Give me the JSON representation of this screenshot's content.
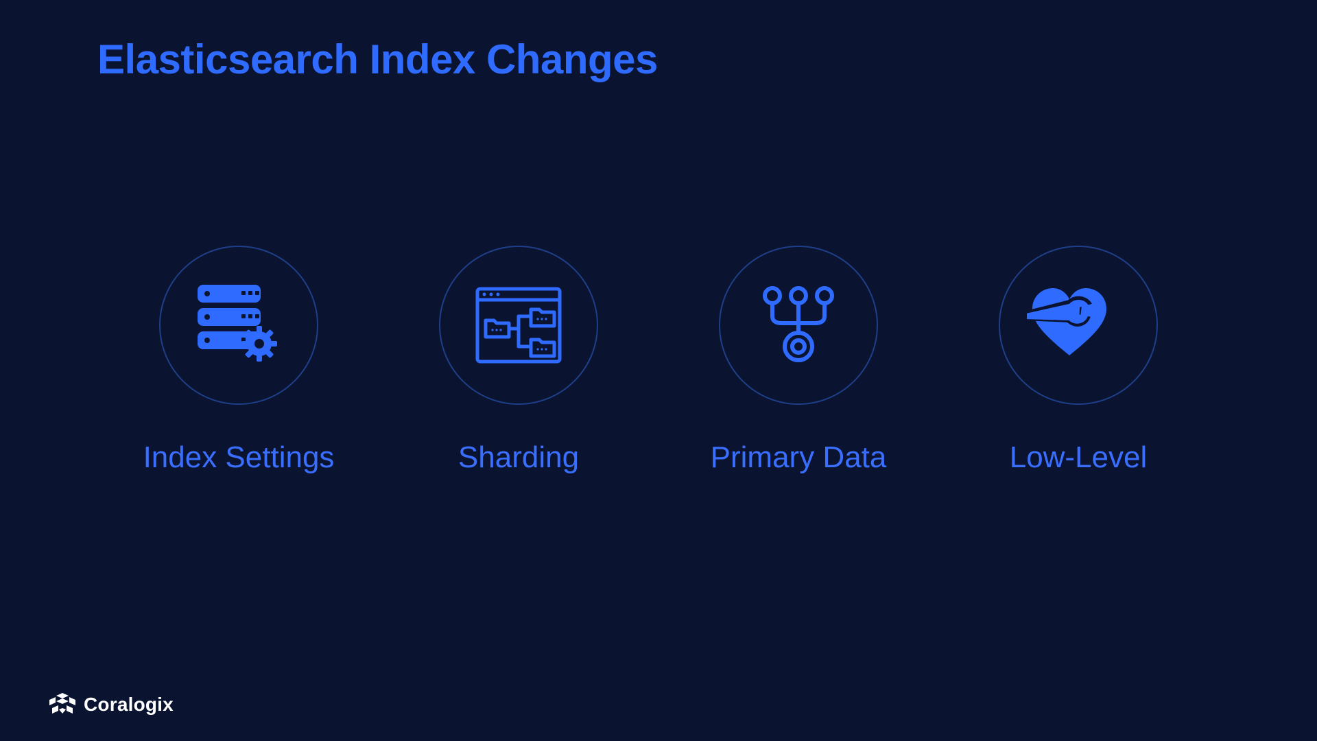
{
  "slide": {
    "title": "Elasticsearch Index Changes",
    "items": [
      {
        "label": "Index Settings",
        "icon": "server-gear-icon"
      },
      {
        "label": "Sharding",
        "icon": "folder-tree-icon"
      },
      {
        "label": "Primary Data",
        "icon": "branches-icon"
      },
      {
        "label": "Low-Level",
        "icon": "heart-wrench-icon"
      }
    ]
  },
  "footer": {
    "brand": "Coralogix"
  },
  "colors": {
    "bg": "#0a1430",
    "accent": "#2f6bff",
    "circle": "#1f3f89",
    "brand": "#ffffff"
  }
}
